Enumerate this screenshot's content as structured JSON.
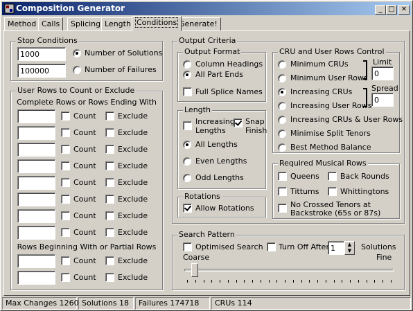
{
  "window": {
    "title": "Composition Generator",
    "controls": {
      "minimize": "_",
      "maximize": "□",
      "close": "✕"
    }
  },
  "tabs": [
    {
      "label": "Method",
      "active": false
    },
    {
      "label": "Calls",
      "active": false
    },
    {
      "label": "Splicing",
      "active": false
    },
    {
      "label": "Length",
      "active": false
    },
    {
      "label": "Conditions",
      "active": true
    },
    {
      "label": "Generate!",
      "active": false
    }
  ],
  "stop_conditions": {
    "legend": "Stop Conditions",
    "solutions_value": "1000",
    "solutions_label": "Number of Solutions",
    "solutions_selected": true,
    "failures_value": "100000",
    "failures_label": "Number of Failures",
    "failures_selected": false
  },
  "user_rows": {
    "legend": "User Rows to Count or Exclude",
    "complete_header": "Complete Rows or Rows Ending With",
    "partial_header": "Rows Beginning With or Partial Rows",
    "count_label": "Count",
    "exclude_label": "Exclude",
    "complete_rows": [
      "",
      "",
      "",
      "",
      "",
      "",
      "",
      ""
    ],
    "partial_rows": [
      "",
      ""
    ]
  },
  "output_criteria": {
    "legend": "Output Criteria",
    "output_format": {
      "legend": "Output Format",
      "column_headings": "Column Headings",
      "all_part_ends": "All Part Ends",
      "selected": "all_part_ends",
      "full_splice_names": "Full Splice Names",
      "full_splice_checked": false
    },
    "length": {
      "legend": "Length",
      "increasing_lengths": "Increasing Lengths",
      "increasing_checked": false,
      "snap_finish": "Snap Finish",
      "snap_checked": true,
      "all_lengths": "All Lengths",
      "even_lengths": "Even Lengths",
      "odd_lengths": "Odd Lengths",
      "selected": "all_lengths"
    },
    "rotations": {
      "legend": "Rotations",
      "allow_rotations": "Allow Rotations",
      "allow_checked": true
    },
    "cru_control": {
      "legend": "CRU and User Rows Control",
      "options": [
        "Minimum CRUs",
        "Minimum User Rows",
        "Increasing CRUs",
        "Increasing User Rows",
        "Increasing CRUs & User Rows",
        "Minimise Split Tenors",
        "Best Method Balance"
      ],
      "selected_index": 2,
      "limit_label": "Limit",
      "limit_value": "0",
      "spread_label": "Spread",
      "spread_value": "0"
    },
    "musical_rows": {
      "legend": "Required Musical Rows",
      "queens": "Queens",
      "back_rounds": "Back Rounds",
      "tittums": "Tittums",
      "whittingtons": "Whittingtons",
      "no_crossed_tenors_line1": "No Crossed Tenors at",
      "no_crossed_tenors_line2": "Backstroke (65s or 87s)"
    }
  },
  "search_pattern": {
    "legend": "Search Pattern",
    "optimised_search": "Optimised Search",
    "turn_off_after": "Turn Off After",
    "turn_off_value": "1",
    "solutions_label": "Solutions",
    "coarse_label": "Coarse",
    "fine_label": "Fine",
    "slider_fraction": 0.05
  },
  "status": {
    "max_changes": "Max Changes 1260",
    "solutions": "Solutions 18",
    "failures": "Failures  174718",
    "crus": "CRUs 114"
  }
}
